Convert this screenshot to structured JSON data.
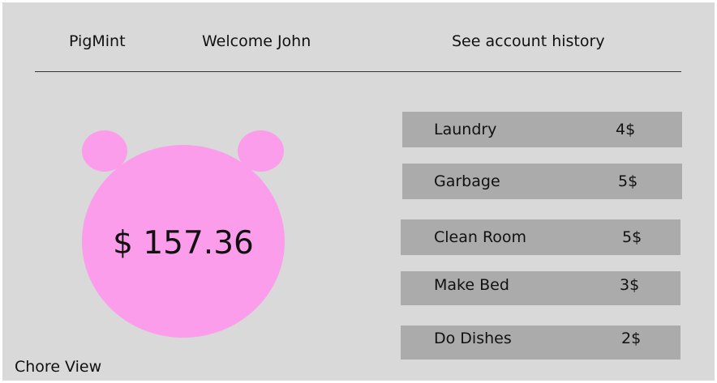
{
  "header": {
    "brand": "PigMint",
    "welcome": "Welcome John",
    "account_history_link": "See account history"
  },
  "balance": {
    "amount": "$ 157.36"
  },
  "chores": [
    {
      "name": "Laundry",
      "price": "4$"
    },
    {
      "name": "Garbage",
      "price": "5$"
    },
    {
      "name": "Clean Room",
      "price": "5$"
    },
    {
      "name": "Make Bed",
      "price": "3$"
    },
    {
      "name": "Do Dishes",
      "price": "2$"
    }
  ],
  "footer": {
    "view_label": "Chore View"
  },
  "colors": {
    "background": "#d9d9d9",
    "pig_pink": "#fb9deb",
    "chore_row": "#ababab"
  }
}
